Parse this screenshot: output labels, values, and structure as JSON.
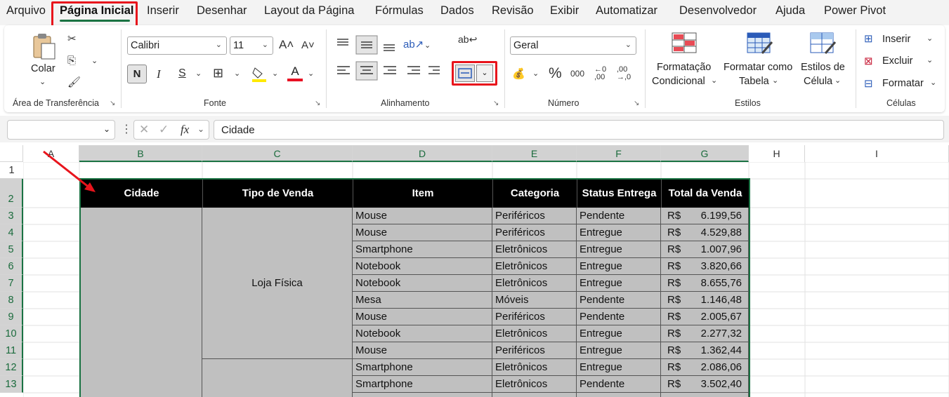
{
  "menu": {
    "items": [
      "Arquivo",
      "Página Inicial",
      "Inserir",
      "Desenhar",
      "Layout da Página",
      "Fórmulas",
      "Dados",
      "Revisão",
      "Exibir",
      "Automatizar",
      "Desenvolvedor",
      "Ajuda",
      "Power Pivot"
    ],
    "active": "Página Inicial"
  },
  "ribbon": {
    "clipboard": {
      "paste_label": "Colar",
      "group_label": "Área de Transferência"
    },
    "font": {
      "name": "Calibri",
      "size": "11",
      "group_label": "Fonte",
      "bold": "N",
      "italic": "I",
      "underline": "S"
    },
    "alignment": {
      "group_label": "Alinhamento"
    },
    "number": {
      "format": "Geral",
      "group_label": "Número",
      "percent": "%",
      "thousands": "000"
    },
    "styles": {
      "conditional_line1": "Formatação",
      "conditional_line2": "Condicional",
      "table_line1": "Formatar como",
      "table_line2": "Tabela",
      "cell_styles_line1": "Estilos de",
      "cell_styles_line2": "Célula",
      "group_label": "Estilos"
    },
    "cells": {
      "insert": "Inserir",
      "delete": "Excluir",
      "format": "Formatar",
      "group_label": "Células"
    }
  },
  "formula_bar": {
    "name_box": "",
    "fx": "fx",
    "content": "Cidade"
  },
  "grid": {
    "columns": [
      "A",
      "B",
      "C",
      "D",
      "E",
      "F",
      "G",
      "H",
      "I"
    ],
    "rows": [
      "1",
      "2",
      "3",
      "4",
      "5",
      "6",
      "7",
      "8",
      "9",
      "10",
      "11",
      "12",
      "13"
    ],
    "headers": [
      "Cidade",
      "Tipo de Venda",
      "Item",
      "Categoria",
      "Status Entrega",
      "Total da Venda"
    ],
    "merged_tipo": "Loja Física",
    "currency": "R$",
    "data": [
      [
        "Mouse",
        "Periféricos",
        "Pendente",
        "6.199,56"
      ],
      [
        "Mouse",
        "Periféricos",
        "Entregue",
        "4.529,88"
      ],
      [
        "Smartphone",
        "Eletrônicos",
        "Entregue",
        "1.007,96"
      ],
      [
        "Notebook",
        "Eletrônicos",
        "Entregue",
        "3.820,66"
      ],
      [
        "Notebook",
        "Eletrônicos",
        "Entregue",
        "8.655,76"
      ],
      [
        "Mesa",
        "Móveis",
        "Pendente",
        "1.146,48"
      ],
      [
        "Mouse",
        "Periféricos",
        "Pendente",
        "2.005,67"
      ],
      [
        "Notebook",
        "Eletrônicos",
        "Entregue",
        "2.277,32"
      ],
      [
        "Mouse",
        "Periféricos",
        "Entregue",
        "1.362,44"
      ],
      [
        "Smartphone",
        "Eletrônicos",
        "Entregue",
        "2.086,06"
      ],
      [
        "Smartphone",
        "Eletrônicos",
        "Pendente",
        "3.502,40"
      ]
    ]
  },
  "colors": {
    "accent": "#1a7343",
    "highlight_box": "#e8141c",
    "data_fill": "#c0c0c0",
    "header_fill": "#000000"
  }
}
